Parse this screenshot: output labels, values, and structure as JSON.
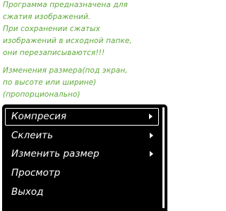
{
  "info": {
    "block1": [
      "Программа предназначена для",
      "сжатия изображений.",
      "При сохранении сжатых",
      "изображений в исходной папке,",
      "они перезаписываются!!!"
    ],
    "block2": [
      "Изменения размера(под экран,",
      "по высоте или ширине)",
      "(пропорционально)"
    ]
  },
  "menu": {
    "items": [
      {
        "label": "Компресия",
        "submenu": true,
        "selected": true
      },
      {
        "label": "Склеить",
        "submenu": true,
        "selected": false
      },
      {
        "label": "Изменить размер",
        "submenu": true,
        "selected": false
      },
      {
        "label": "Просмотр",
        "submenu": false,
        "selected": false
      },
      {
        "label": "Выход",
        "submenu": false,
        "selected": false
      }
    ]
  },
  "colors": {
    "info_text": "#5ea83a",
    "menu_bg": "#000000",
    "menu_text": "#ffffff"
  },
  "icons": {
    "submenu": "chevron-right-icon"
  }
}
